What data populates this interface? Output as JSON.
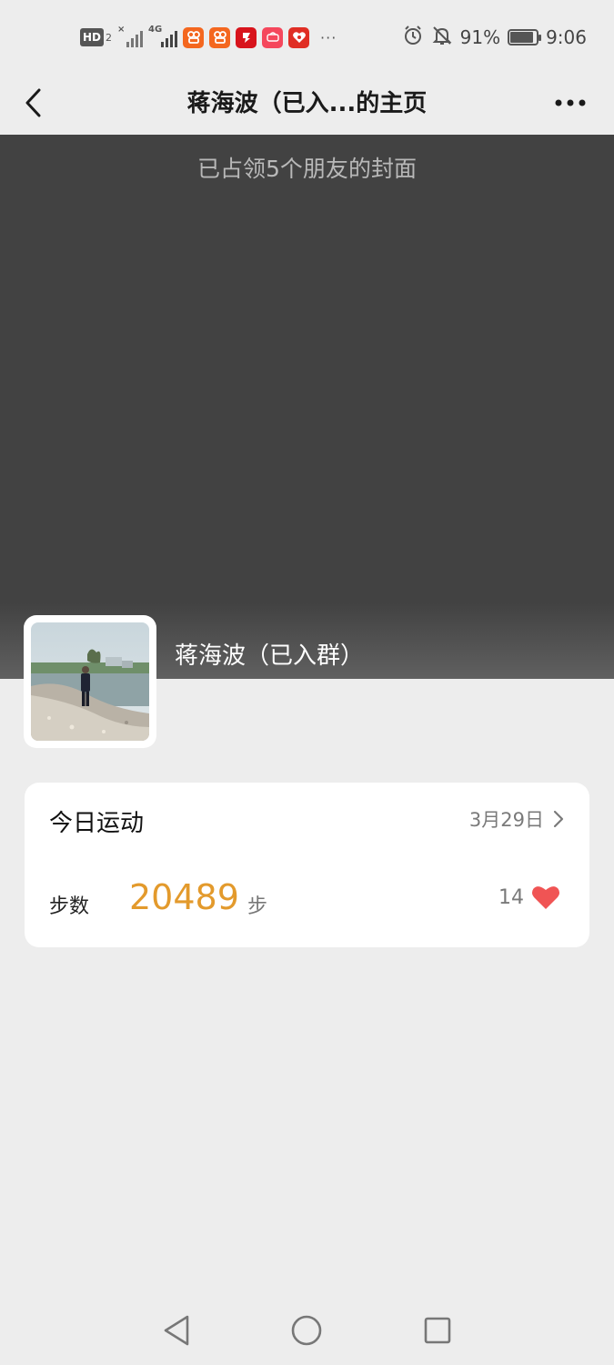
{
  "status_bar": {
    "hd_label": "HD",
    "hd_sub": "2",
    "network_label": "4G",
    "overflow": "···",
    "battery_percent": "91%",
    "battery_level": 0.91,
    "time": "9:06",
    "icons": [
      "hd-icon",
      "signal-icon",
      "signal-4g-icon",
      "kuaishou-icon",
      "kuaishou-icon",
      "tv-app-icon",
      "taobao-icon",
      "pinduoduo-icon",
      "alarm-icon",
      "mute-icon",
      "battery-icon"
    ]
  },
  "nav": {
    "title": "蒋海波（已入...的主页",
    "back_icon": "chevron-left-icon",
    "more_icon": "more-horizontal-icon"
  },
  "cover": {
    "text": "已占领5个朋友的封面"
  },
  "profile": {
    "name": "蒋海波（已入群）"
  },
  "sport_card": {
    "title": "今日运动",
    "date": "3月29日",
    "steps_label": "步数",
    "steps_value": "20489",
    "steps_unit": "步",
    "likes_count": "14"
  },
  "colors": {
    "background": "#ededed",
    "cover": "#424242",
    "steps_accent": "#e39a2c",
    "like_heart": "#f05454"
  },
  "system_nav": {
    "icons": [
      "back-triangle-icon",
      "home-circle-icon",
      "recents-square-icon"
    ]
  }
}
